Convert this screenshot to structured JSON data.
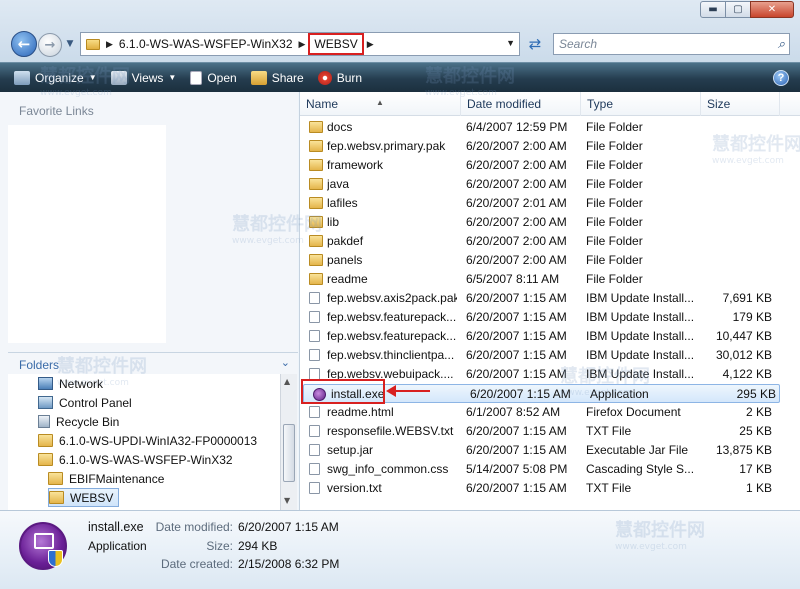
{
  "window": {
    "min_glyph": "▬",
    "max_glyph": "▢",
    "close_glyph": "✕"
  },
  "address": {
    "crumbs": [
      "6.1.0-WS-WAS-WSFEP-WinX32",
      "WEBSV"
    ]
  },
  "search": {
    "placeholder": "Search"
  },
  "toolbar": {
    "organize": "Organize",
    "views": "Views",
    "open": "Open",
    "share": "Share",
    "burn": "Burn",
    "help": "?"
  },
  "nav_pane": {
    "favorite_links": "Favorite Links",
    "folders": "Folders",
    "tree": [
      {
        "label": "Network",
        "icon": "network-icon"
      },
      {
        "label": "Control Panel",
        "icon": "control-panel-icon"
      },
      {
        "label": "Recycle Bin",
        "icon": "recycle-bin-icon"
      },
      {
        "label": "6.1.0-WS-UPDI-WinIA32-FP0000013",
        "icon": "folder-icon"
      },
      {
        "label": "6.1.0-WS-WAS-WSFEP-WinX32",
        "icon": "folder-icon"
      },
      {
        "label": "EBIFMaintenance",
        "icon": "folder-icon"
      },
      {
        "label": "WEBSV",
        "icon": "folder-icon"
      }
    ]
  },
  "columns": {
    "name": "Name",
    "date": "Date modified",
    "type": "Type",
    "size": "Size"
  },
  "files": [
    {
      "name": "docs",
      "date": "6/4/2007 12:59 PM",
      "type": "File Folder",
      "size": "",
      "icon": "folder-icon"
    },
    {
      "name": "fep.websv.primary.pak",
      "date": "6/20/2007 2:00 AM",
      "type": "File Folder",
      "size": "",
      "icon": "folder-icon"
    },
    {
      "name": "framework",
      "date": "6/20/2007 2:00 AM",
      "type": "File Folder",
      "size": "",
      "icon": "folder-icon"
    },
    {
      "name": "java",
      "date": "6/20/2007 2:00 AM",
      "type": "File Folder",
      "size": "",
      "icon": "folder-icon"
    },
    {
      "name": "lafiles",
      "date": "6/20/2007 2:01 AM",
      "type": "File Folder",
      "size": "",
      "icon": "folder-icon"
    },
    {
      "name": "lib",
      "date": "6/20/2007 2:00 AM",
      "type": "File Folder",
      "size": "",
      "icon": "folder-icon"
    },
    {
      "name": "pakdef",
      "date": "6/20/2007 2:00 AM",
      "type": "File Folder",
      "size": "",
      "icon": "folder-icon"
    },
    {
      "name": "panels",
      "date": "6/20/2007 2:00 AM",
      "type": "File Folder",
      "size": "",
      "icon": "folder-icon"
    },
    {
      "name": "readme",
      "date": "6/5/2007 8:11 AM",
      "type": "File Folder",
      "size": "",
      "icon": "folder-icon"
    },
    {
      "name": "fep.websv.axis2pack.pak",
      "date": "6/20/2007 1:15 AM",
      "type": "IBM Update Install...",
      "size": "7,691 KB",
      "icon": "document-icon"
    },
    {
      "name": "fep.websv.featurepack....",
      "date": "6/20/2007 1:15 AM",
      "type": "IBM Update Install...",
      "size": "179 KB",
      "icon": "document-icon"
    },
    {
      "name": "fep.websv.featurepack....",
      "date": "6/20/2007 1:15 AM",
      "type": "IBM Update Install...",
      "size": "10,447 KB",
      "icon": "document-icon"
    },
    {
      "name": "fep.websv.thinclientpa...",
      "date": "6/20/2007 1:15 AM",
      "type": "IBM Update Install...",
      "size": "30,012 KB",
      "icon": "document-icon"
    },
    {
      "name": "fep.websv.webuipack....",
      "date": "6/20/2007 1:15 AM",
      "type": "IBM Update Install...",
      "size": "4,122 KB",
      "icon": "document-icon"
    },
    {
      "name": "install.exe",
      "date": "6/20/2007 1:15 AM",
      "type": "Application",
      "size": "295 KB",
      "icon": "installer-icon"
    },
    {
      "name": "readme.html",
      "date": "6/1/2007 8:52 AM",
      "type": "Firefox Document",
      "size": "2 KB",
      "icon": "html-document-icon"
    },
    {
      "name": "responsefile.WEBSV.txt",
      "date": "6/20/2007 1:15 AM",
      "type": "TXT File",
      "size": "25 KB",
      "icon": "text-file-icon"
    },
    {
      "name": "setup.jar",
      "date": "6/20/2007 1:15 AM",
      "type": "Executable Jar File",
      "size": "13,875 KB",
      "icon": "jar-file-icon"
    },
    {
      "name": "swg_info_common.css",
      "date": "5/14/2007 5:08 PM",
      "type": "Cascading Style S...",
      "size": "17 KB",
      "icon": "css-file-icon"
    },
    {
      "name": "version.txt",
      "date": "6/20/2007 1:15 AM",
      "type": "TXT File",
      "size": "1 KB",
      "icon": "text-file-icon"
    }
  ],
  "details": {
    "name": "install.exe",
    "kind": "Application",
    "date_modified_label": "Date modified:",
    "date_modified": "6/20/2007 1:15 AM",
    "size_label": "Size:",
    "size": "294 KB",
    "date_created_label": "Date created:",
    "date_created": "2/15/2008 6:32 PM"
  },
  "watermark": {
    "brand": "慧都控件网",
    "url": "www.evget.com"
  },
  "colors": {
    "toolbar": "#253d4f",
    "highlight_red": "#d82020",
    "selection": "#d4e7fb",
    "link_blue": "#3a6ba8"
  }
}
